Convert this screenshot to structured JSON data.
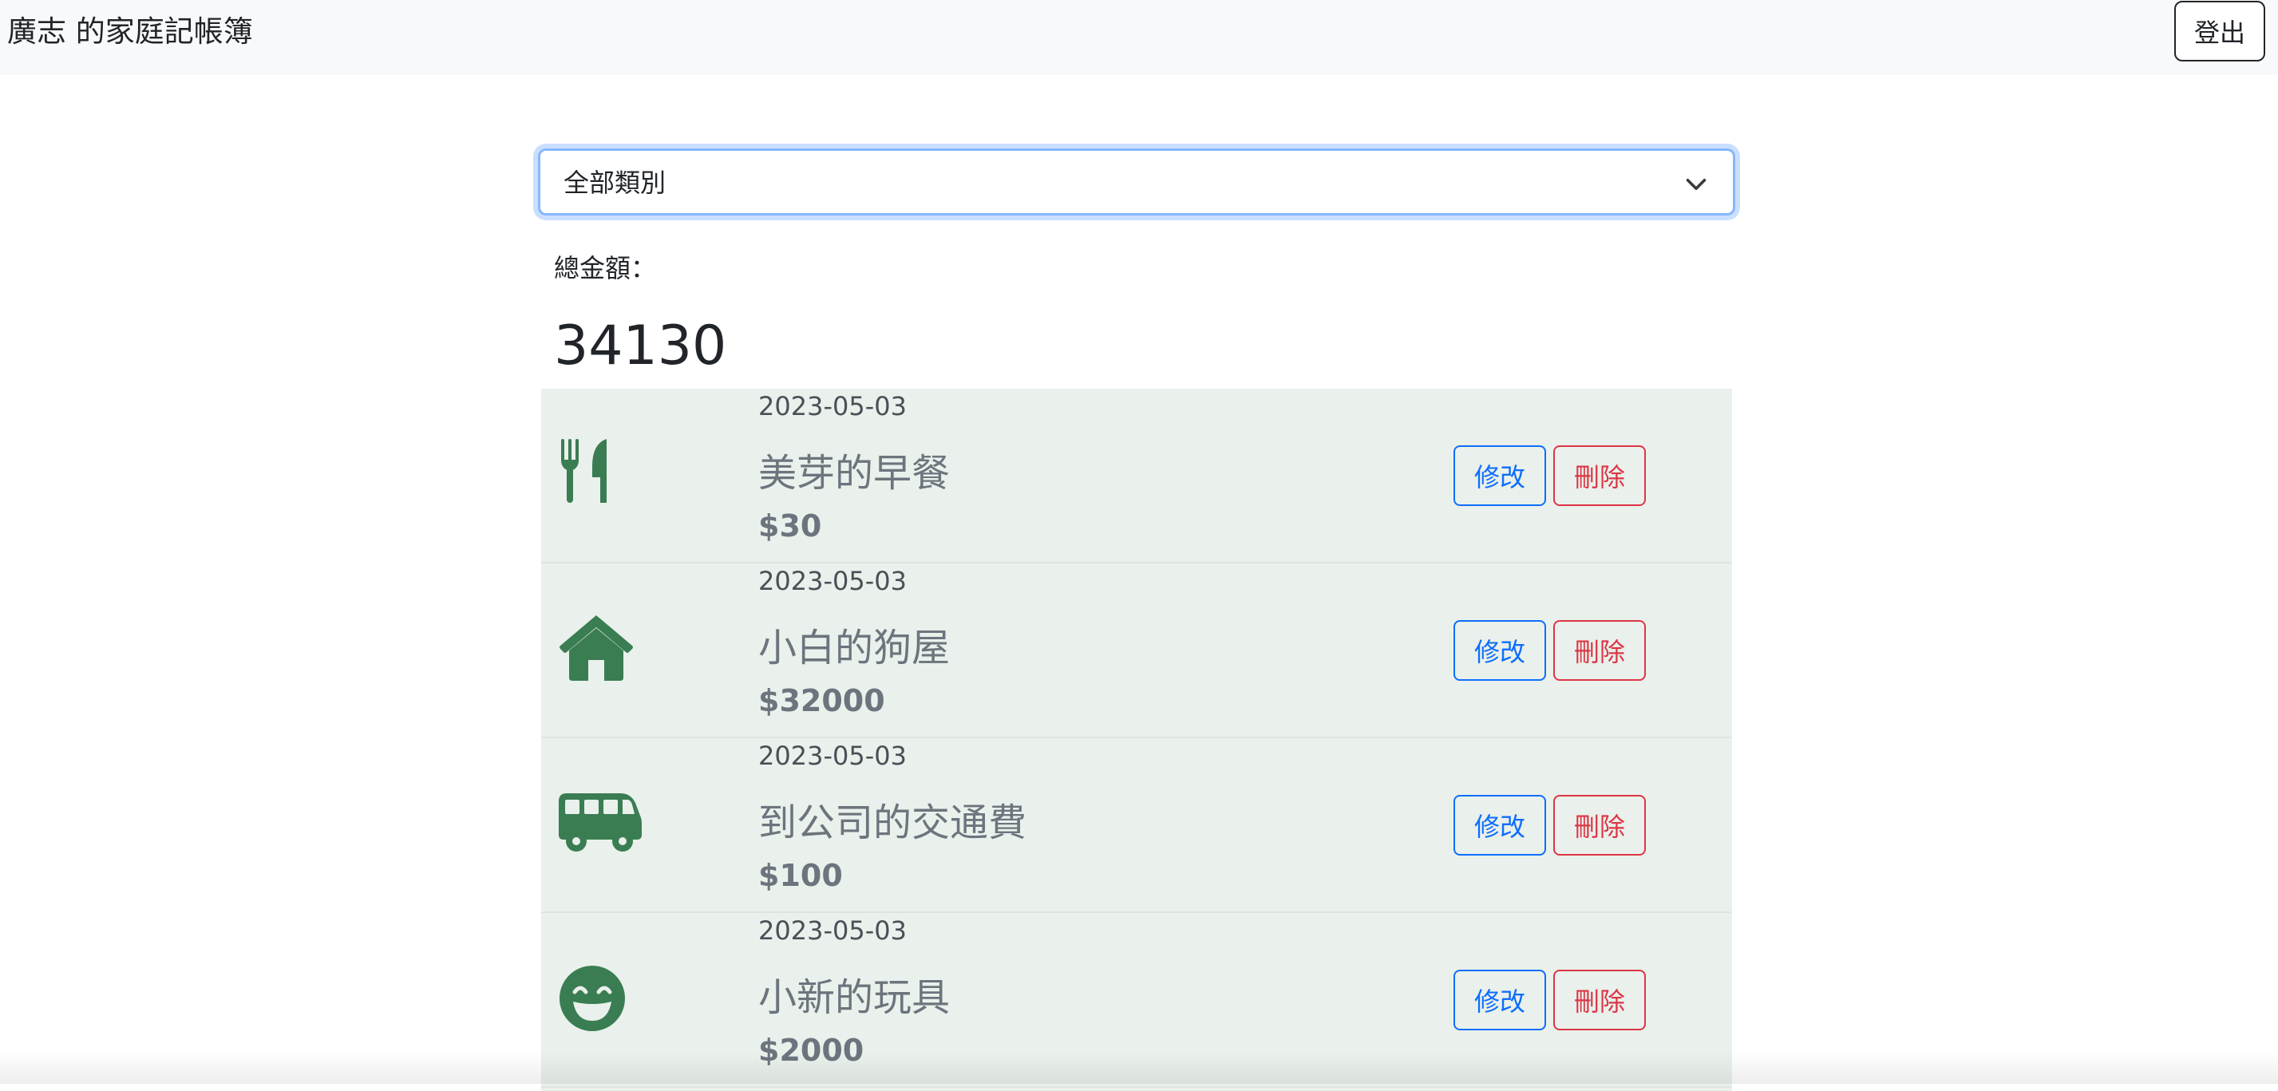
{
  "navbar": {
    "brand": "廣志 的家庭記帳簿",
    "logout_label": "登出"
  },
  "filter": {
    "selected_option": "全部類別"
  },
  "summary": {
    "total_label": "總金額：",
    "total_value": "34130"
  },
  "records": [
    {
      "icon": "utensils-icon",
      "date": "2023-05-03",
      "name": "美芽的早餐",
      "amount": "$30",
      "edit_label": "修改",
      "delete_label": "刪除"
    },
    {
      "icon": "house-icon",
      "date": "2023-05-03",
      "name": "小白的狗屋",
      "amount": "$32000",
      "edit_label": "修改",
      "delete_label": "刪除"
    },
    {
      "icon": "van-icon",
      "date": "2023-05-03",
      "name": "到公司的交通費",
      "amount": "$100",
      "edit_label": "修改",
      "delete_label": "刪除"
    },
    {
      "icon": "grin-face-icon",
      "date": "2023-05-03",
      "name": "小新的玩具",
      "amount": "$2000",
      "edit_label": "修改",
      "delete_label": "刪除"
    }
  ],
  "colors": {
    "icon_green": "#3a7d53",
    "edit_blue": "#0d6efd",
    "delete_red": "#dc3545",
    "list_background": "#eaf0eb"
  }
}
